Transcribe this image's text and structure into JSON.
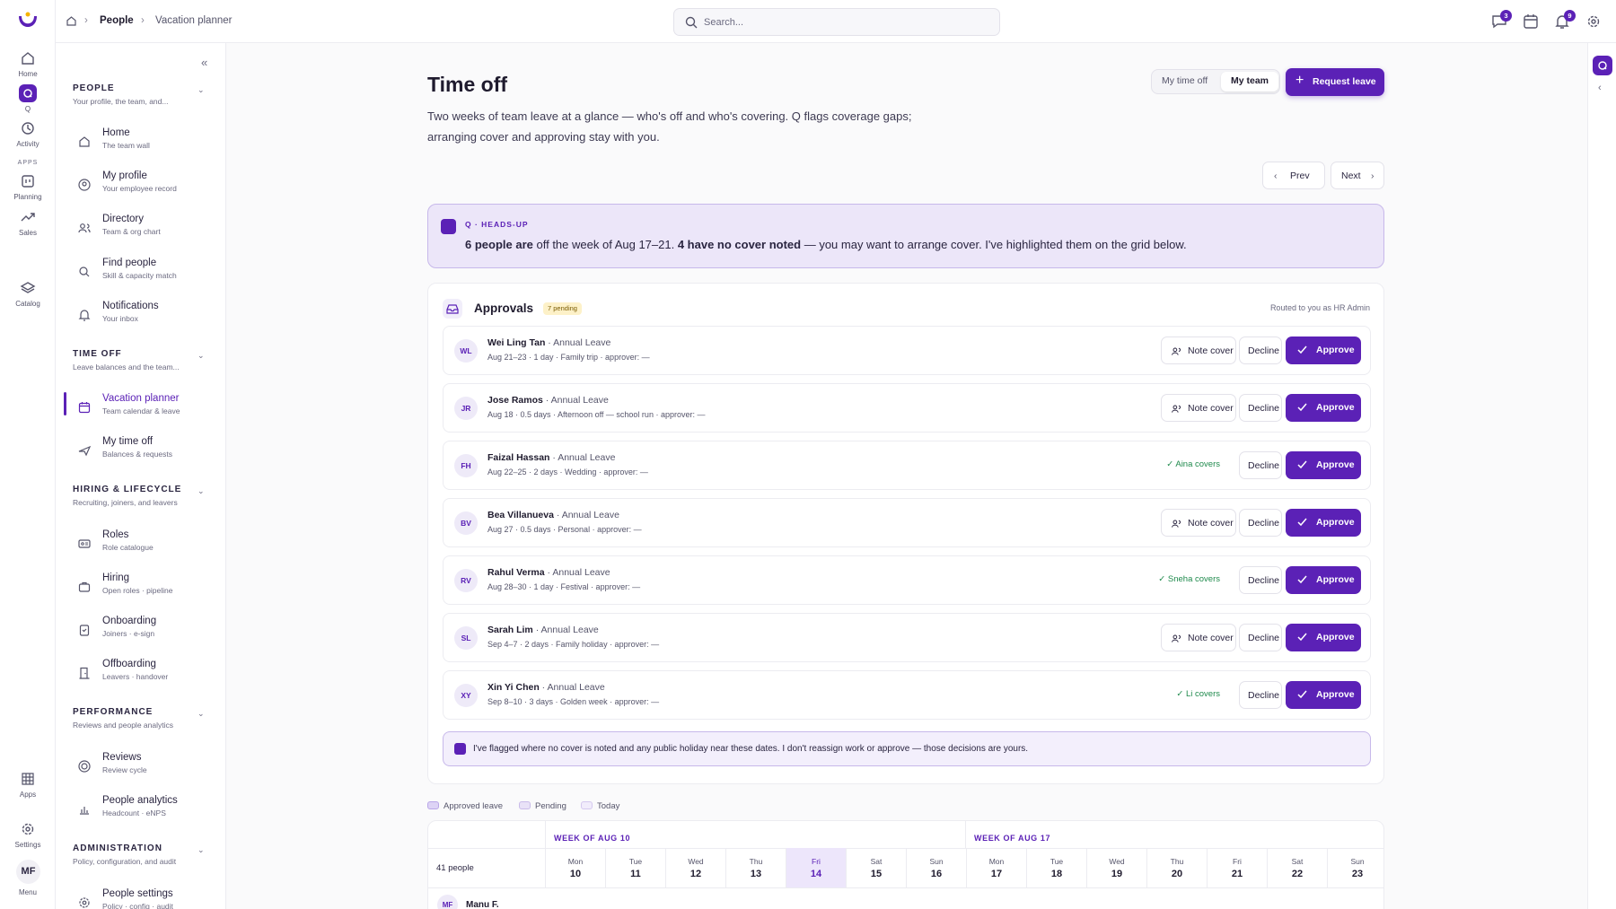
{
  "rail": {
    "items": [
      {
        "label": "Home",
        "icon": "home-icon"
      },
      {
        "label": "Q",
        "icon": "q-assistant-icon"
      },
      {
        "label": "Activity",
        "icon": "history-icon"
      },
      {
        "label": "Planning",
        "icon": "planning-icon"
      },
      {
        "label": "Sales",
        "icon": "trend-icon"
      },
      {
        "label": "Catalog",
        "icon": "layers-icon"
      }
    ],
    "apps_label": "APPS",
    "bottom": [
      {
        "label": "Apps",
        "icon": "grid-icon"
      },
      {
        "label": "Settings",
        "icon": "gear-icon"
      }
    ],
    "user_initials": "MF",
    "menu_label": "Menu"
  },
  "breadcrumb": {
    "root": "People",
    "current": "Vacation planner"
  },
  "search": {
    "placeholder": "Search..."
  },
  "top_icons": {
    "messages_badge": "3",
    "notifications_badge": "9"
  },
  "sidebar": {
    "sections": [
      {
        "title": "PEOPLE",
        "subtitle": "Your profile, the team, and...",
        "items": [
          {
            "label": "Home",
            "sub": "The team wall",
            "icon": "home-icon"
          },
          {
            "label": "My profile",
            "sub": "Your employee record",
            "icon": "user-circle-icon"
          },
          {
            "label": "Directory",
            "sub": "Team & org chart",
            "icon": "users-icon"
          },
          {
            "label": "Find people",
            "sub": "Skill & capacity match",
            "icon": "search-icon"
          },
          {
            "label": "Notifications",
            "sub": "Your inbox",
            "icon": "bell-icon"
          }
        ]
      },
      {
        "title": "TIME OFF",
        "subtitle": "Leave balances and the team...",
        "items": [
          {
            "label": "Vacation planner",
            "sub": "Team calendar & leave",
            "icon": "calendar-icon",
            "active": true
          },
          {
            "label": "My time off",
            "sub": "Balances & requests",
            "icon": "plane-icon"
          }
        ]
      },
      {
        "title": "HIRING & LIFECYCLE",
        "subtitle": "Recruiting, joiners, and leavers",
        "items": [
          {
            "label": "Roles",
            "sub": "Role catalogue",
            "icon": "id-card-icon"
          },
          {
            "label": "Hiring",
            "sub": "Open roles · pipeline",
            "icon": "briefcase-icon"
          },
          {
            "label": "Onboarding",
            "sub": "Joiners · e-sign",
            "icon": "clipboard-icon"
          },
          {
            "label": "Offboarding",
            "sub": "Leavers · handover",
            "icon": "door-icon"
          }
        ]
      },
      {
        "title": "PERFORMANCE",
        "subtitle": "Reviews and people analytics",
        "items": [
          {
            "label": "Reviews",
            "sub": "Review cycle",
            "icon": "target-icon"
          },
          {
            "label": "People analytics",
            "sub": "Headcount · eNPS",
            "icon": "bar-chart-icon"
          }
        ]
      },
      {
        "title": "ADMINISTRATION",
        "subtitle": "Policy, configuration, and audit",
        "items": [
          {
            "label": "People settings",
            "sub": "Policy · config · audit",
            "icon": "gear-icon"
          }
        ]
      }
    ]
  },
  "page": {
    "title": "Time off",
    "description": "Two weeks of team leave at a glance — who's off and who's covering. Q flags coverage gaps; arranging cover and approving stay with you.",
    "toggle": {
      "option1": "My time off",
      "option2": "My team",
      "selected": "My team"
    },
    "request_button": "Request leave",
    "prev": "Prev",
    "next": "Next"
  },
  "heads_up": {
    "tag": "Q · HEADS-UP",
    "bold1": "6 people are",
    "text1": " off the week of Aug 17–21. ",
    "bold2": "4 have no cover noted",
    "text2": " — you may want to arrange cover. I've highlighted them on the grid below."
  },
  "approvals": {
    "title": "Approvals",
    "pending": "7 pending",
    "routed": "Routed to you as HR Admin",
    "note_cover_label": "Note cover",
    "decline_label": "Decline",
    "approve_label": "Approve",
    "rows": [
      {
        "initials": "WL",
        "name": "Wei Ling Tan",
        "type": " · Annual Leave",
        "detail": "Aug 21–23 · 1 day · Family trip · approver: —",
        "covers": ""
      },
      {
        "initials": "JR",
        "name": "Jose Ramos",
        "type": " · Annual Leave",
        "detail": "Aug 18 · 0.5 days · Afternoon off — school run · approver: —",
        "covers": ""
      },
      {
        "initials": "FH",
        "name": "Faizal Hassan",
        "type": " · Annual Leave",
        "detail": "Aug 22–25 · 2 days · Wedding · approver: —",
        "covers": "Aina covers"
      },
      {
        "initials": "BV",
        "name": "Bea Villanueva",
        "type": " · Annual Leave",
        "detail": "Aug 27 · 0.5 days · Personal · approver: —",
        "covers": ""
      },
      {
        "initials": "RV",
        "name": "Rahul Verma",
        "type": " · Annual Leave",
        "detail": "Aug 28–30 · 1 day · Festival · approver: —",
        "covers": "Sneha covers"
      },
      {
        "initials": "SL",
        "name": "Sarah Lim",
        "type": " · Annual Leave",
        "detail": "Sep 4–7 · 2 days · Family holiday · approver: —",
        "covers": ""
      },
      {
        "initials": "XY",
        "name": "Xin Yi Chen",
        "type": " · Annual Leave",
        "detail": "Sep 8–10 · 3 days · Golden week · approver: —",
        "covers": "Li covers"
      }
    ],
    "footnote": "I've flagged where no cover is noted and any public holiday near these dates. I don't reassign work or approve — those decisions are yours."
  },
  "legend": {
    "approved": "Approved leave",
    "pending": "Pending",
    "today": "Today"
  },
  "calendar": {
    "week1": "WEEK OF AUG 10",
    "week2": "WEEK OF AUG 17",
    "people_count": "41 people",
    "days": [
      {
        "dn": "Mon",
        "dd": "10"
      },
      {
        "dn": "Tue",
        "dd": "11"
      },
      {
        "dn": "Wed",
        "dd": "12"
      },
      {
        "dn": "Thu",
        "dd": "13"
      },
      {
        "dn": "Fri",
        "dd": "14",
        "today": true
      },
      {
        "dn": "Sat",
        "dd": "15"
      },
      {
        "dn": "Sun",
        "dd": "16"
      },
      {
        "dn": "Mon",
        "dd": "17"
      },
      {
        "dn": "Tue",
        "dd": "18"
      },
      {
        "dn": "Wed",
        "dd": "19"
      },
      {
        "dn": "Thu",
        "dd": "20"
      },
      {
        "dn": "Fri",
        "dd": "21"
      },
      {
        "dn": "Sat",
        "dd": "22"
      },
      {
        "dn": "Sun",
        "dd": "23"
      }
    ],
    "first_row": {
      "initials": "MF",
      "name": "Manu F."
    }
  },
  "colors": {
    "accent": "#5b21b6",
    "accent_soft": "#ece6f9",
    "success": "#1f8a4c"
  }
}
